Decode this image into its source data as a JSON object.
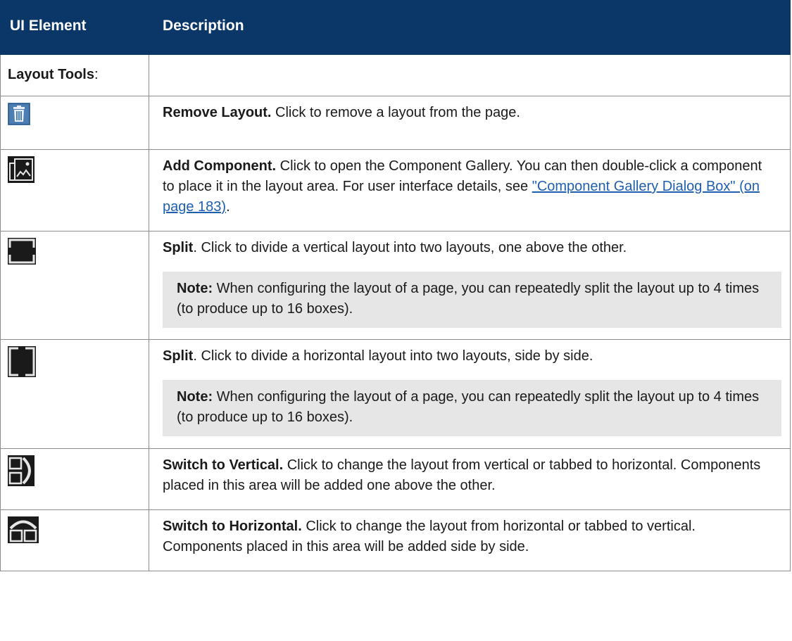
{
  "header": {
    "col_element": "UI Element",
    "col_description": "Description"
  },
  "section": {
    "label": "Layout Tools",
    "suffix": ":"
  },
  "rows": [
    {
      "icon": "trash-icon",
      "title": "Remove Layout.",
      "text": " Click to remove a layout from the page."
    },
    {
      "icon": "add-component-icon",
      "title": "Add Component.",
      "text": " Click to open the Component Gallery. You can then double-click a component to place it in the layout area. For user interface details, see ",
      "link": "\"Component Gallery Dialog Box\" (on page 183)",
      "after_link": "."
    },
    {
      "icon": "split-vertical-icon",
      "title": "Split",
      "text": ". Click to divide a vertical layout into two layouts, one above the other.",
      "note_label": "Note:",
      "note_text": "  When configuring the layout of a page, you can repeatedly split the layout up to 4 times (to produce up to 16 boxes)."
    },
    {
      "icon": "split-horizontal-icon",
      "title": "Split",
      "text": ". Click to divide a horizontal layout into two layouts, side by side.",
      "note_label": "Note:",
      "note_text": "  When configuring the layout of a page, you can repeatedly split the layout up to 4 times (to produce up to 16 boxes)."
    },
    {
      "icon": "switch-to-vertical-icon",
      "title": "Switch to Vertical.",
      "text": " Click to change the layout from vertical or tabbed to horizontal. Components placed in this area will be added one above the other."
    },
    {
      "icon": "switch-to-horizontal-icon",
      "title": "Switch to Horizontal.",
      "text": " Click to change the layout from horizontal or tabbed to vertical. Components placed in this area will be added side by side."
    }
  ],
  "colors": {
    "header_bg": "#0a3668",
    "header_text": "#ffffff",
    "note_bg": "#e6e6e6",
    "link": "#1f5fb0",
    "border": "#8c8c8c"
  }
}
